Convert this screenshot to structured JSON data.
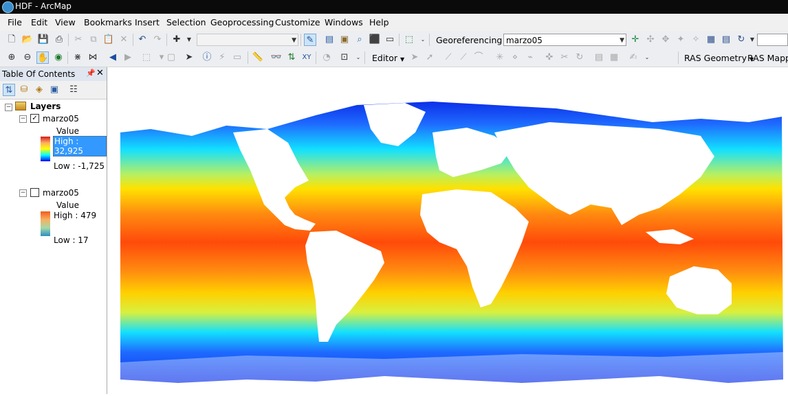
{
  "window": {
    "title": "HDF - ArcMap"
  },
  "menu": [
    "File",
    "Edit",
    "View",
    "Bookmarks",
    "Insert",
    "Selection",
    "Geoprocessing",
    "Customize",
    "Windows",
    "Help"
  ],
  "toolbar1": {
    "georeferencing_label": "Georeferencing",
    "georef_layer": "marzo05"
  },
  "toolbar2": {
    "editor_label": "Editor",
    "ras_geometry_label": "RAS Geometry",
    "ras_mapping_label": "RAS Mappi"
  },
  "toc": {
    "title": "Table Of Contents",
    "group_name": "Layers",
    "layers": [
      {
        "name": "marzo05",
        "checked": true,
        "value_label": "Value",
        "high": "High : 32,925",
        "low": "Low : -1,725",
        "ramp": [
          "#d7191c",
          "#fdae61",
          "#ffff00",
          "#00ffff",
          "#0000ff"
        ]
      },
      {
        "name": "marzo05",
        "checked": false,
        "value_label": "Value",
        "high": "High : 479",
        "low": "Low : 17",
        "ramp": [
          "#f35a1f",
          "#f7b15e",
          "#a5d8a8",
          "#2b8fc2"
        ]
      }
    ]
  },
  "map": {
    "description_colors": {
      "warm": "#ff3b0a",
      "mid": "#ffe100",
      "cool": "#12e0ff",
      "cold": "#0b2fe8"
    }
  }
}
